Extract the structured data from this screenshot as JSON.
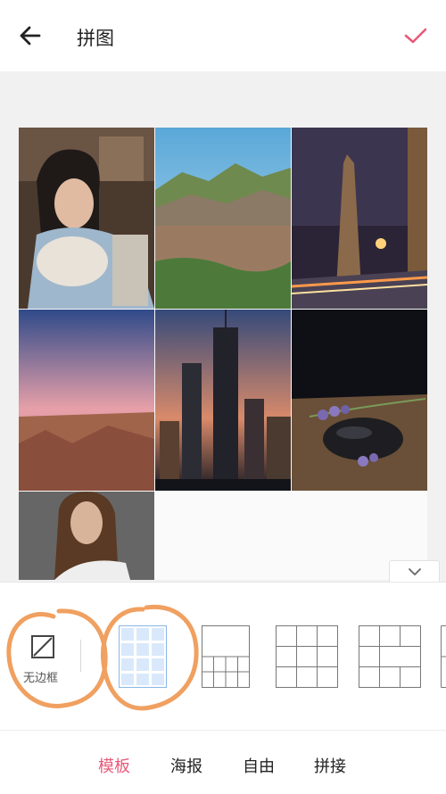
{
  "header": {
    "title": "拼图"
  },
  "panel": {
    "no_border_label": "无边框"
  },
  "tabs": [
    {
      "label": "模板"
    },
    {
      "label": "海报"
    },
    {
      "label": "自由"
    },
    {
      "label": "拼接"
    }
  ],
  "colors": {
    "accent": "#e85a7a",
    "annotation": "#f0a060",
    "selected_template": "#d9e9fb"
  }
}
